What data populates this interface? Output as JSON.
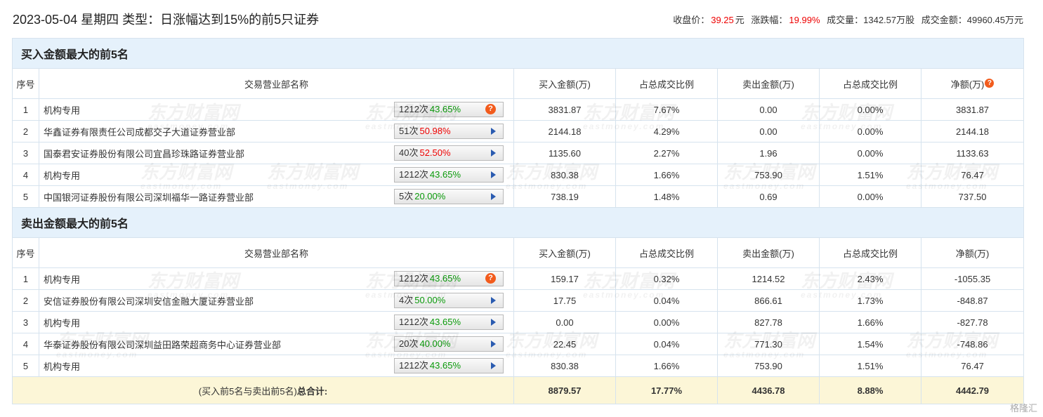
{
  "header": {
    "title": "2023-05-04 星期四 类型：日涨幅达到15%的前5只证券",
    "close_label": "收盘价：",
    "close_value": "39.25",
    "close_unit": "元",
    "change_label": "涨跌幅：",
    "change_value": "19.99%",
    "volume": "成交量：1342.57万股",
    "turnover": "成交金额：49960.45万元"
  },
  "columns": {
    "index": "序号",
    "name": "交易营业部名称",
    "buy": "买入金额(万)",
    "buy_ratio": "占总成交比例",
    "sell": "卖出金额(万)",
    "sell_ratio": "占总成交比例",
    "net": "净额(万)"
  },
  "buy_section": {
    "title": "买入金额最大的前5名",
    "rows": [
      {
        "idx": "1",
        "name": "机构专用",
        "count": "1212次",
        "pct": "43.65%",
        "pct_color": "green",
        "icon": "question-icon",
        "buy": "3831.87",
        "buy_ratio": "7.67%",
        "sell": "0.00",
        "sell_ratio": "0.00%",
        "net": "3831.87",
        "sell_color": "",
        "net_color": "red"
      },
      {
        "idx": "2",
        "name": "华鑫证券有限责任公司成都交子大道证券营业部",
        "count": "51次",
        "pct": "50.98%",
        "pct_color": "red",
        "icon": "play-icon",
        "buy": "2144.18",
        "buy_ratio": "4.29%",
        "sell": "0.00",
        "sell_ratio": "0.00%",
        "net": "2144.18",
        "sell_color": "",
        "net_color": "red"
      },
      {
        "idx": "3",
        "name": "国泰君安证券股份有限公司宜昌珍珠路证券营业部",
        "count": "40次",
        "pct": "52.50%",
        "pct_color": "red",
        "icon": "play-icon",
        "buy": "1135.60",
        "buy_ratio": "2.27%",
        "sell": "1.96",
        "sell_ratio": "0.00%",
        "net": "1133.63",
        "sell_color": "green",
        "net_color": "red"
      },
      {
        "idx": "4",
        "name": "机构专用",
        "count": "1212次",
        "pct": "43.65%",
        "pct_color": "green",
        "icon": "play-icon",
        "buy": "830.38",
        "buy_ratio": "1.66%",
        "sell": "753.90",
        "sell_ratio": "1.51%",
        "net": "76.47",
        "sell_color": "green",
        "net_color": "red"
      },
      {
        "idx": "5",
        "name": "中国银河证券股份有限公司深圳福华一路证券营业部",
        "count": "5次",
        "pct": "20.00%",
        "pct_color": "green",
        "icon": "play-icon",
        "buy": "738.19",
        "buy_ratio": "1.48%",
        "sell": "0.69",
        "sell_ratio": "0.00%",
        "net": "737.50",
        "sell_color": "green",
        "net_color": "red"
      }
    ]
  },
  "sell_section": {
    "title": "卖出金额最大的前5名",
    "rows": [
      {
        "idx": "1",
        "name": "机构专用",
        "count": "1212次",
        "pct": "43.65%",
        "pct_color": "green",
        "icon": "question-icon",
        "buy": "159.17",
        "buy_ratio": "0.32%",
        "sell": "1214.52",
        "sell_ratio": "2.43%",
        "net": "-1055.35",
        "sell_color": "green",
        "net_color": "green"
      },
      {
        "idx": "2",
        "name": "安信证券股份有限公司深圳安信金融大厦证券营业部",
        "count": "4次",
        "pct": "50.00%",
        "pct_color": "green",
        "icon": "play-icon",
        "buy": "17.75",
        "buy_ratio": "0.04%",
        "sell": "866.61",
        "sell_ratio": "1.73%",
        "net": "-848.87",
        "sell_color": "green",
        "net_color": "green"
      },
      {
        "idx": "3",
        "name": "机构专用",
        "count": "1212次",
        "pct": "43.65%",
        "pct_color": "green",
        "icon": "play-icon",
        "buy": "0.00",
        "buy_ratio": "0.00%",
        "sell": "827.78",
        "sell_ratio": "1.66%",
        "net": "-827.78",
        "sell_color": "green",
        "net_color": "green"
      },
      {
        "idx": "4",
        "name": "华泰证券股份有限公司深圳益田路荣超商务中心证券营业部",
        "count": "20次",
        "pct": "40.00%",
        "pct_color": "green",
        "icon": "play-icon",
        "buy": "22.45",
        "buy_ratio": "0.04%",
        "sell": "771.30",
        "sell_ratio": "1.54%",
        "net": "-748.86",
        "sell_color": "green",
        "net_color": "green"
      },
      {
        "idx": "5",
        "name": "机构专用",
        "count": "1212次",
        "pct": "43.65%",
        "pct_color": "green",
        "icon": "play-icon",
        "buy": "830.38",
        "buy_ratio": "1.66%",
        "sell": "753.90",
        "sell_ratio": "1.51%",
        "net": "76.47",
        "sell_color": "green",
        "net_color": "red"
      }
    ]
  },
  "total": {
    "label_prefix": "(买入前5名与卖出前5名)",
    "label_bold": "总合计:",
    "buy": "8879.57",
    "buy_ratio": "17.77%",
    "sell": "4436.78",
    "sell_ratio": "8.88%",
    "net": "4442.79"
  },
  "watermark": {
    "cn": "东方财富网",
    "en": "eastmoney.com"
  },
  "corner_logo": "格隆汇",
  "colors": {
    "red": "#e60012",
    "green": "#089908",
    "section_bg": "#e5f1fb",
    "total_bg": "#fcf6d7"
  }
}
